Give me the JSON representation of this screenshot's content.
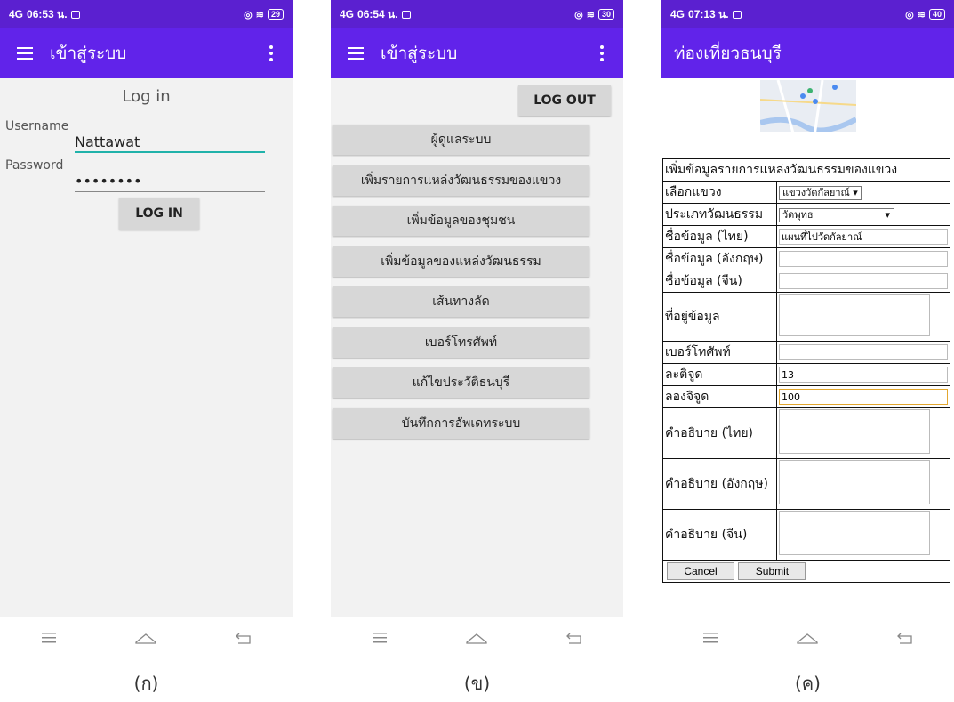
{
  "screens": [
    {
      "status": {
        "time": "06:53 น.",
        "battery": "29"
      },
      "appbar": {
        "title": "เข้าสู่ระบบ"
      },
      "login": {
        "heading": "Log in",
        "username_label": "Username",
        "username_value": "Nattawat",
        "password_label": "Password",
        "password_value": "••••••••",
        "button": "LOG IN"
      },
      "caption": "(ก)"
    },
    {
      "status": {
        "time": "06:54 น.",
        "battery": "30"
      },
      "appbar": {
        "title": "เข้าสู่ระบบ"
      },
      "logout": "LOG OUT",
      "menu": [
        "ผู้ดูแลระบบ",
        "เพิ่มรายการแหล่งวัฒนธรรมของแขวง",
        "เพิ่มข้อมูลของชุมชน",
        "เพิ่มข้อมูลของแหล่งวัฒนธรรม",
        "เส้นทางลัด",
        "เบอร์โทรศัพท์",
        "แก้ไขประวัติธนบุรี",
        "บันทึกการอัพเดทระบบ"
      ],
      "caption": "(ข)"
    },
    {
      "status": {
        "time": "07:13 น.",
        "battery": "40"
      },
      "appbar": {
        "title": "ท่องเที่ยวธนบุรี"
      },
      "form": {
        "heading": "เพิ่มข้อมูลรายการแหล่งวัฒนธรรมของแขวง",
        "district_label": "เลือกแขวง",
        "district_value": "แขวงวัดกัลยาณ์",
        "type_label": "ประเภทวัฒนธรรม",
        "type_value": "วัดพุทธ",
        "name_th_label": "ชื่อข้อมูล (ไทย)",
        "name_th_value": "แผนที่ไปวัดกัลยาณ์",
        "name_en_label": "ชื่อข้อมูล (อังกฤษ)",
        "name_cn_label": "ชื่อข้อมูล (จีน)",
        "address_label": "ที่อยู่ข้อมูล",
        "phone_label": "เบอร์โทศัพท์",
        "lat_label": "ละติจูด",
        "lat_value": "13",
        "lng_label": "ลองจิจูด",
        "lng_value": "100",
        "desc_th_label": "คำอธิบาย (ไทย)",
        "desc_en_label": "คำอธิบาย (อังกฤษ)",
        "desc_cn_label": "คำอธิบาย (จีน)",
        "cancel": "Cancel",
        "submit": "Submit"
      },
      "caption": "(ค)"
    }
  ],
  "colors": {
    "statusbar": "#5b20d0",
    "appbar": "#6123ea",
    "button": "#d7d7d7",
    "accent_line": "#20b2aa",
    "focus": "#e3a72f"
  },
  "icons": [
    "hamburger-menu-icon",
    "overflow-menu-icon",
    "recent-apps-icon",
    "home-icon",
    "back-icon",
    "signal-icon",
    "wifi-icon",
    "location-icon",
    "battery-icon",
    "message-icon"
  ]
}
